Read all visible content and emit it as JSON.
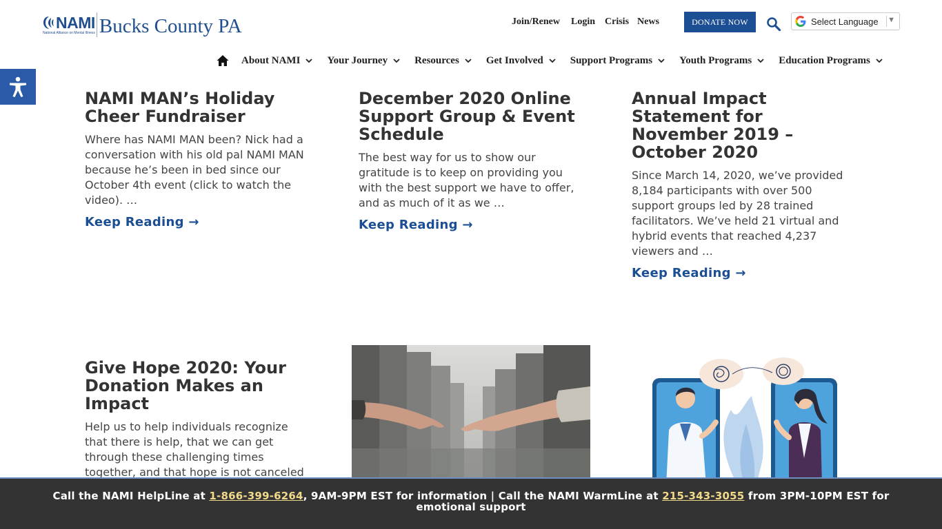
{
  "header": {
    "logo_brand": "NAMI",
    "logo_tagline": "National Alliance on Mental Illness",
    "logo_text": "Bucks County PA",
    "top_links": [
      "Join/Renew",
      "Login",
      "Crisis",
      "News"
    ],
    "donate_label": "DONATE NOW",
    "language_label": "Select Language"
  },
  "nav": {
    "items": [
      "About NAMI",
      "Your Journey",
      "Resources",
      "Get Involved",
      "Support Programs",
      "Youth Programs",
      "Education Programs"
    ]
  },
  "posts": [
    {
      "title": "NAMI MAN’s Holiday Cheer Fundraiser",
      "excerpt": "Where has NAMI MAN been? Nick had a conversation with his old pal NAMI MAN because he’s been in bed since our October 4th event (click to watch the video). …",
      "more": "Keep Reading →"
    },
    {
      "title": "December 2020 Online Support Group & Event Schedule",
      "excerpt": "The best way for us to show our gratitude is to keep on providing you with the best support we have to offer, and as much of it as we …",
      "more": "Keep Reading →"
    },
    {
      "title": "Annual Impact Statement for November 2019 – October 2020",
      "excerpt": "Since March 14, 2020, we’ve provided 8,184 participants with over 500 support groups led by 28 trained facilitators. We’ve held 21 virtual and hybrid events that reached 4,237 viewers and …",
      "more": "Keep Reading →"
    },
    {
      "title": "Give Hope 2020: Your Donation Makes an Impact",
      "excerpt": "Help us to help individuals recognize that there is help, that we can get through these challenging times together, and that hope is not canceled"
    }
  ],
  "footer": {
    "part1": "Call the NAMI HelpLine at ",
    "helpline": "1-866-399-6264",
    "part2": ", 9AM-9PM EST for information  |  Call the NAMI WarmLine at ",
    "warmline": "215-343-3055",
    "part3": " from 3PM-10PM EST for emotional support"
  },
  "colors": {
    "brand_blue": "#1c4e94",
    "footer_bg": "#333333",
    "phone_link": "#f1d98a"
  }
}
